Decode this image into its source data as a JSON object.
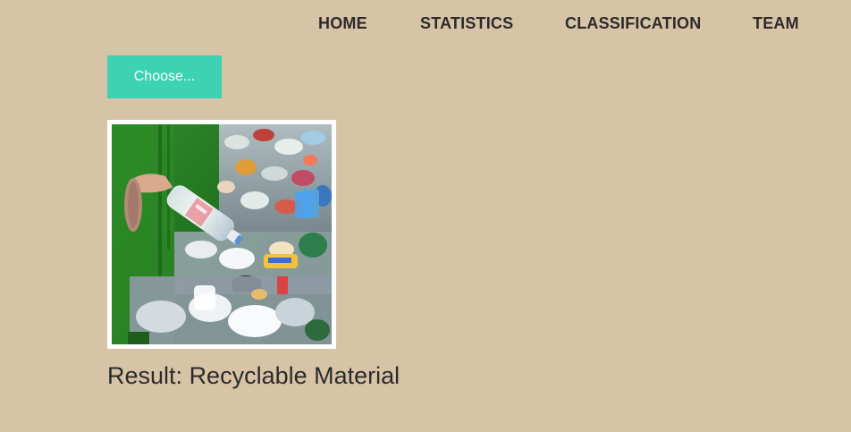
{
  "nav": {
    "items": [
      {
        "label": "HOME"
      },
      {
        "label": "STATISTICS"
      },
      {
        "label": "CLASSIFICATION"
      },
      {
        "label": "TEAM"
      }
    ]
  },
  "upload": {
    "button_label": "Choose..."
  },
  "image": {
    "alt": "Recyclable plastic bottles on a sorting conveyor"
  },
  "result": {
    "prefix": "Result:",
    "value": "Recyclable Material"
  },
  "colors": {
    "background": "#d7c4a7",
    "accent": "#3cd2b2",
    "text": "#2b2b2b"
  }
}
